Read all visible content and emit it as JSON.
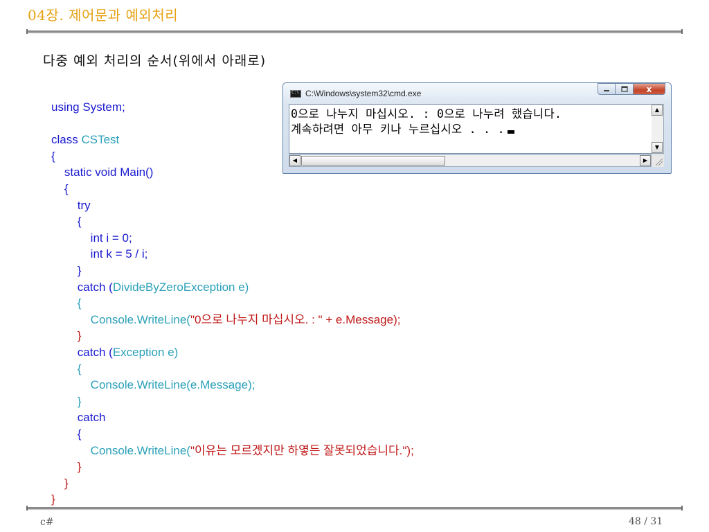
{
  "header": {
    "title": "04장. 제어문과 예외처리"
  },
  "slide": {
    "heading": "다중 예외 처리의 순서(위에서 아래로)"
  },
  "code": [
    [
      {
        "t": "using System;",
        "c": "kw"
      }
    ],
    [],
    [
      {
        "t": "class ",
        "c": "kw"
      },
      {
        "t": "CSTest",
        "c": "ty"
      }
    ],
    [
      {
        "t": "{",
        "c": "kw"
      }
    ],
    [
      {
        "t": "    static void Main()",
        "c": "kw"
      }
    ],
    [
      {
        "t": "    {",
        "c": "kw"
      }
    ],
    [
      {
        "t": "        try",
        "c": "kw"
      }
    ],
    [
      {
        "t": "        {",
        "c": "kw"
      }
    ],
    [
      {
        "t": "            int i = 0;",
        "c": "kw"
      }
    ],
    [
      {
        "t": "            int k = 5 / i;",
        "c": "kw"
      }
    ],
    [
      {
        "t": "        }",
        "c": "kw"
      }
    ],
    [
      {
        "t": "        catch (",
        "c": "kw"
      },
      {
        "t": "DivideByZeroException e)",
        "c": "ty"
      }
    ],
    [
      {
        "t": "        {",
        "c": "ty"
      }
    ],
    [
      {
        "t": "            Console.WriteLine(",
        "c": "ty"
      },
      {
        "t": "\"0으로 나누지 마십시오. : \" + e.Message);",
        "c": "str"
      }
    ],
    [
      {
        "t": "        }",
        "c": "br"
      }
    ],
    [
      {
        "t": "        catch (",
        "c": "kw"
      },
      {
        "t": "Exception e)",
        "c": "ty"
      }
    ],
    [
      {
        "t": "        {",
        "c": "ty"
      }
    ],
    [
      {
        "t": "            Console.WriteLine(e.Message);",
        "c": "ty"
      }
    ],
    [
      {
        "t": "        }",
        "c": "ty"
      }
    ],
    [
      {
        "t": "        catch",
        "c": "kw"
      }
    ],
    [
      {
        "t": "        {",
        "c": "kw"
      }
    ],
    [
      {
        "t": "            Console.WriteLine(",
        "c": "ty"
      },
      {
        "t": "\"이유는 모르겠지만 하옇든 잘못되었습니다.\");",
        "c": "str"
      }
    ],
    [
      {
        "t": "        }",
        "c": "br"
      }
    ],
    [
      {
        "t": "    }",
        "c": "br"
      }
    ],
    [
      {
        "t": "}",
        "c": "br"
      }
    ]
  ],
  "console": {
    "title": "C:\\Windows\\system32\\cmd.exe",
    "lines": [
      "0으로 나누지 마십시오. : 0으로 나누려 했습니다.",
      "계속하려면 아무 키나 누르십시오 . . ."
    ],
    "close_label": "x"
  },
  "footer": {
    "left": "c#",
    "page": "48 / 31"
  }
}
